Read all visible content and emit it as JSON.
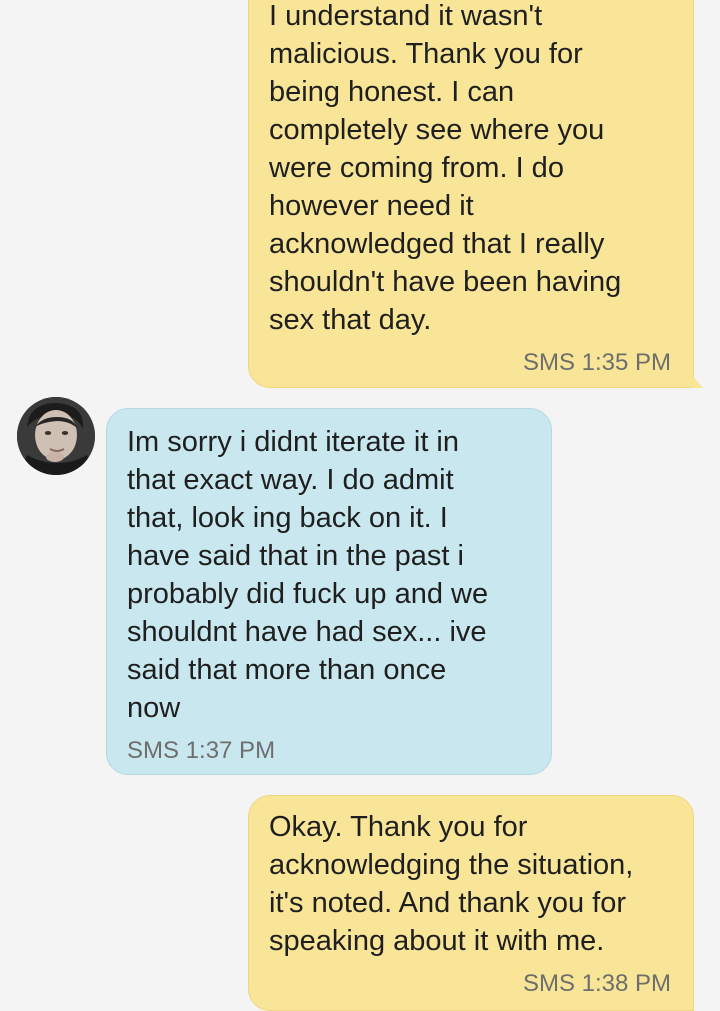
{
  "conversation": {
    "messages": [
      {
        "direction": "sent",
        "text": "I understand it wasn't\nmalicious. Thank you for\nbeing honest. I can\ncompletely see where you\nwere coming from. I do\nhowever need it\nacknowledged that I really\nshouldn't have been having\nsex that day.",
        "meta": "SMS 1:35 PM"
      },
      {
        "direction": "received",
        "text": "Im sorry i didnt iterate it in\nthat exact way. I do admit\nthat, look ing back on it. I\nhave said that in the past i\nprobably did fuck up and we\nshouldnt have had sex... ive\nsaid that more than once\nnow",
        "meta": "SMS 1:37 PM",
        "avatar_icon": "contact-avatar"
      },
      {
        "direction": "sent",
        "text": "Okay. Thank you for\nacknowledging the situation,\nit's noted. And thank you for\nspeaking about it with me.",
        "meta": "SMS 1:38 PM"
      }
    ]
  },
  "colors": {
    "background": "#f4f4f4",
    "sent_bubble": "#f8e597",
    "received_bubble": "#c9e7ee",
    "meta_text": "#6e6e6e"
  }
}
